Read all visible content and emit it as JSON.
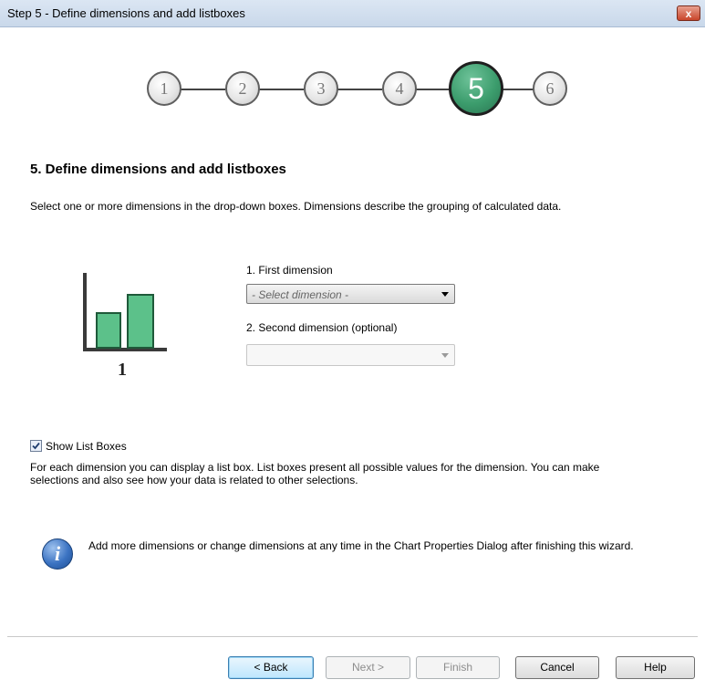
{
  "window": {
    "title": "Step 5 - Define dimensions and add listboxes",
    "close_label": "x"
  },
  "steps": [
    {
      "label": "1",
      "active": false
    },
    {
      "label": "2",
      "active": false
    },
    {
      "label": "3",
      "active": false
    },
    {
      "label": "4",
      "active": false
    },
    {
      "label": "5",
      "active": true
    },
    {
      "label": "6",
      "active": false
    }
  ],
  "main": {
    "heading": "5. Define dimensions and add listboxes",
    "description": "Select one or more dimensions in the drop-down boxes. Dimensions describe the grouping of calculated data.",
    "chart_icon_number": "1"
  },
  "dimensions": {
    "first_label": "1. First dimension",
    "first_value": "- Select dimension -",
    "second_label": "2. Second dimension (optional)",
    "second_value": ""
  },
  "listboxes": {
    "checkbox_label": "Show List Boxes",
    "checked": true,
    "description": "For each dimension you can display a list box. List boxes present all possible values for the dimension. You can make selections and also see how your data is related to other selections."
  },
  "info": {
    "text": "Add more dimensions or change dimensions at any time in the Chart Properties Dialog after finishing this wizard."
  },
  "buttons": {
    "back": "< Back",
    "next": "Next >",
    "finish": "Finish",
    "cancel": "Cancel",
    "help": "Help"
  },
  "colors": {
    "active_step": "#3c9d6d",
    "bar_fill": "#5cc18a",
    "info_blue": "#3b73c2"
  }
}
